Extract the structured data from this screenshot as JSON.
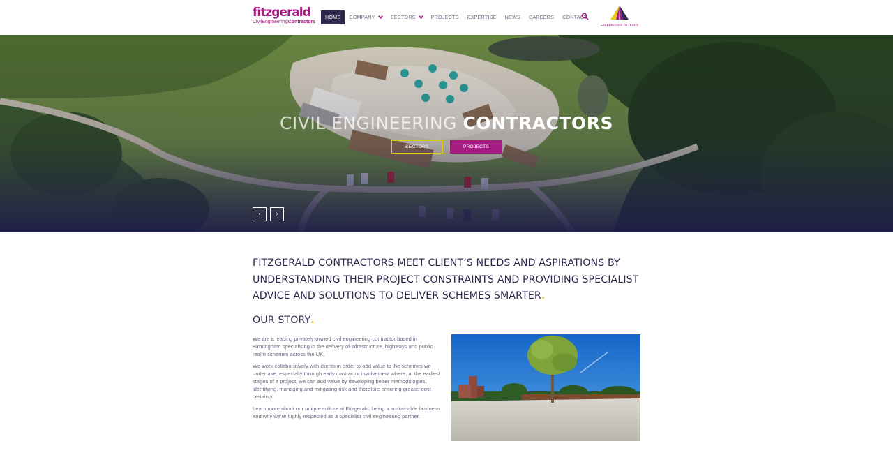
{
  "brand": {
    "logo_word": "fitzgerald",
    "logo_sub_light": "CivilEngineering",
    "logo_sub_bold": "Contractors",
    "accent": "#a51d82",
    "navy": "#2d2a4e",
    "yellow": "#f2c417"
  },
  "nav": {
    "items": [
      {
        "label": "HOME",
        "active": true
      },
      {
        "label": "COMPANY",
        "dropdown": true
      },
      {
        "label": "SECTORS",
        "dropdown": true
      },
      {
        "label": "PROJECTS"
      },
      {
        "label": "EXPERTISE"
      },
      {
        "label": "NEWS"
      },
      {
        "label": "CAREERS"
      },
      {
        "label": "CONTACT"
      }
    ],
    "search_icon": "search-icon"
  },
  "anniversary": {
    "text": "CELEBRATING 70 YEARS"
  },
  "hero": {
    "title_light": "CIVIL ENGINEERING",
    "title_bold": "CONTRACTORS",
    "btn_sectors": "SECTORS",
    "btn_projects": "PROJECTS",
    "prev": "‹",
    "next": "›"
  },
  "intro": {
    "text": "FITZGERALD CONTRACTORS MEET CLIENT’S NEEDS AND ASPIRATIONS BY UNDERSTANDING THEIR PROJECT CONSTRAINTS AND PROVIDING SPECIALIST ADVICE AND SOLUTIONS TO DELIVER SCHEMES SMARTER",
    "dot": "."
  },
  "story": {
    "title": "OUR STORY",
    "dot": ".",
    "paragraphs": [
      "We are a leading privately-owned civil engineering contractor based in Birmingham specialising in the delivery of infrastructure, highways and public realm schemes across the UK.",
      "We work collaboratively with clients in order to add value to the schemes we undertake, especially through early contractor involvement where, at the earliest stages of a project, we can add value by developing better methodologies, identifying, managing and mitigating risk and therefore ensuring greater cost certainty.",
      "Learn more about our unique culture at Fitzgerald, being a sustainable business and why we're highly respected as a specialist civil engineering partner."
    ]
  }
}
